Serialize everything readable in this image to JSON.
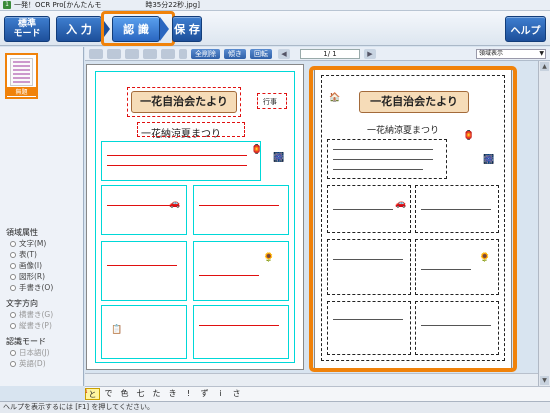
{
  "window": {
    "title": "一発！OCR Pro[かんたんモ",
    "title_suffix": "時35分22秒.jpg]"
  },
  "toolbar": {
    "mode_line1": "標準",
    "mode_line2": "モード",
    "input": "入 力",
    "ocr": "認 識",
    "save": "保 存",
    "help": "ヘルプ"
  },
  "subtoolbar": {
    "buttons": [
      "",
      "",
      "",
      "",
      "",
      "",
      "全削除",
      "傾き",
      "回転"
    ],
    "page": "1/ 1",
    "view_select": "領域表示"
  },
  "thumbnails": [
    {
      "label": "無題"
    }
  ],
  "properties": {
    "region_title": "領域属性",
    "region_options": [
      "文字(M)",
      "表(T)",
      "画像(I)",
      "図形(R)",
      "手書き(O)"
    ],
    "direction_title": "文字方向",
    "direction_options": [
      "横書き(G)",
      "縦書き(P)"
    ],
    "ocr_mode_title": "認識モード",
    "ocr_mode_options": [
      "日本語(J)",
      "英語(D)"
    ]
  },
  "document": {
    "banner": "一花自治会たより",
    "subtitle": "一花納涼夏まつり",
    "tag": "行事"
  },
  "char_strip": [
    "と",
    "で",
    "色",
    "七",
    "た",
    "き",
    "!",
    "ず",
    "i",
    "さ"
  ],
  "status": "ヘルプを表示するには [F1] を押してください。",
  "colors": {
    "accent": "#f0820a",
    "button": "#1d4f9a",
    "cyan_region": "#00d8d8",
    "red_region": "#e01010"
  }
}
